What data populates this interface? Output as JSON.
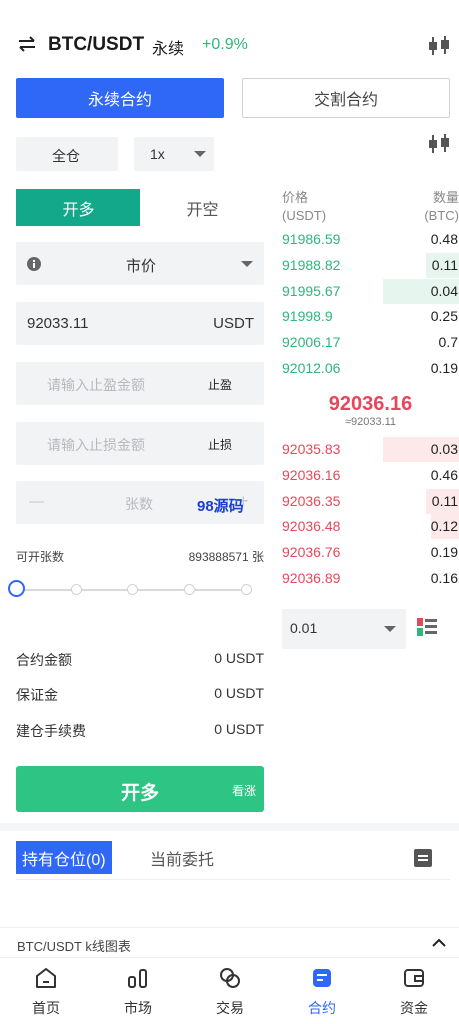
{
  "header": {
    "pair": "BTC/USDT",
    "contract_type": "永续",
    "change": "+0.9%"
  },
  "contract_tabs": {
    "perpetual": "永续合约",
    "delivery": "交割合约"
  },
  "margin": {
    "mode": "全仓",
    "leverage": "1x"
  },
  "side_tabs": {
    "long": "开多",
    "short": "开空"
  },
  "order_type": "市价",
  "price_input": {
    "value": "92033.11",
    "unit": "USDT"
  },
  "take_profit": {
    "placeholder": "请输入止盈金额",
    "label": "止盈"
  },
  "stop_loss": {
    "placeholder": "请输入止损金额",
    "label": "止损"
  },
  "quantity": {
    "minus": "—",
    "placeholder": "张数",
    "plus": "+"
  },
  "watermark": "98源码",
  "available": {
    "label": "可开张数",
    "value": "893888571 张"
  },
  "slider": {
    "value_fraction": 0
  },
  "summary": [
    {
      "label": "合约金额",
      "value": "0 USDT"
    },
    {
      "label": "保证金",
      "value": "0 USDT"
    },
    {
      "label": "建仓手续费",
      "value": "0 USDT"
    }
  ],
  "open_button": {
    "label": "开多",
    "sub": "看涨"
  },
  "orderbook": {
    "price_header": "价格",
    "price_unit": "(USDT)",
    "qty_header": "数量",
    "qty_unit": "(BTC)",
    "asks": [
      {
        "price": "91986.59",
        "qty": "0.48",
        "depth": 0.0
      },
      {
        "price": "91988.82",
        "qty": "0.11",
        "depth": 0.43
      },
      {
        "price": "91995.67",
        "qty": "0.04",
        "depth": 1.0
      },
      {
        "price": "91998.9",
        "qty": "0.25",
        "depth": 0.0
      },
      {
        "price": "92006.17",
        "qty": "0.7",
        "depth": 0.0
      },
      {
        "price": "92012.06",
        "qty": "0.19",
        "depth": 0.0
      }
    ],
    "last_price": "92036.16",
    "last_price_sub": "≈92033.11",
    "bids": [
      {
        "price": "92035.83",
        "qty": "0.03",
        "depth": 1.0
      },
      {
        "price": "92036.16",
        "qty": "0.46",
        "depth": 0.0
      },
      {
        "price": "92036.35",
        "qty": "0.11",
        "depth": 0.43
      },
      {
        "price": "92036.48",
        "qty": "0.12",
        "depth": 0.37
      },
      {
        "price": "92036.76",
        "qty": "0.19",
        "depth": 0.0
      },
      {
        "price": "92036.89",
        "qty": "0.16",
        "depth": 0.0
      }
    ],
    "precision": "0.01"
  },
  "positions": {
    "tab_holdings": "持有仓位(0)",
    "tab_orders": "当前委托"
  },
  "kline_bar": {
    "label": "BTC/USDT k线图表"
  },
  "bottom_nav": [
    {
      "label": "首页",
      "icon": "home-icon"
    },
    {
      "label": "市场",
      "icon": "market-icon"
    },
    {
      "label": "交易",
      "icon": "trade-icon"
    },
    {
      "label": "合约",
      "icon": "contract-icon"
    },
    {
      "label": "资金",
      "icon": "wallet-icon"
    }
  ],
  "colors": {
    "accent_blue": "#2f68f6",
    "long_green": "#13a88a",
    "open_green": "#2ec483",
    "ask_green": "#2eb67d",
    "bid_red": "#e8475b"
  }
}
